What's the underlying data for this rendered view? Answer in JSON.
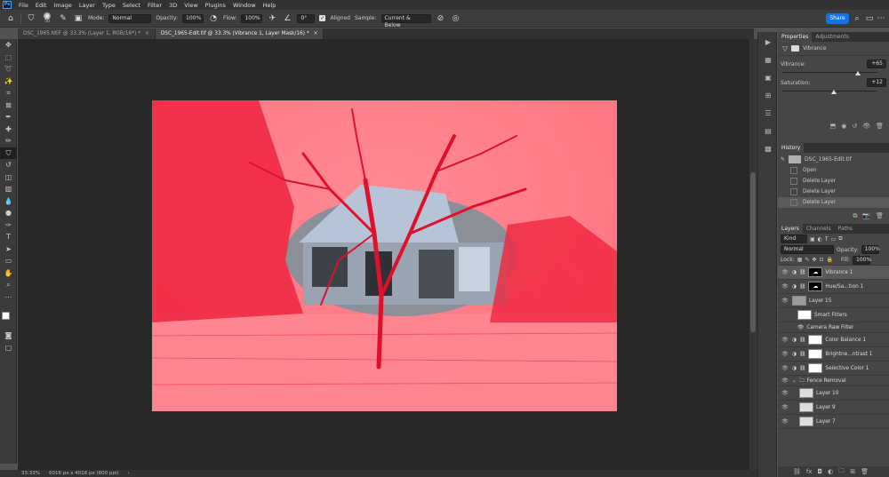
{
  "menubar": {
    "logo": "Ps",
    "items": [
      "File",
      "Edit",
      "Image",
      "Layer",
      "Type",
      "Select",
      "Filter",
      "3D",
      "View",
      "Plugins",
      "Window",
      "Help"
    ]
  },
  "options": {
    "brush_size": "50",
    "mode_label": "Mode:",
    "mode_value": "Normal",
    "opacity_label": "Opacity:",
    "opacity_value": "100%",
    "flow_label": "Flow:",
    "flow_value": "100%",
    "angle_value": "0°",
    "aligned_label": "Aligned",
    "sample_label": "Sample:",
    "sample_value": "Current & Below",
    "share_label": "Share"
  },
  "tabs": [
    {
      "label": "DSC_1965.NEF @ 33.3% (Layer 1, RGB/16*) *",
      "close": "×"
    },
    {
      "label": "DSC_1965-Edit.tif @ 33.3% (Vibrance 1, Layer Mask/16) *",
      "close": "×"
    }
  ],
  "status": {
    "zoom": "33.33%",
    "doc_info": "6016 px x 4016 px (600 ppi)",
    "arrow": "›"
  },
  "properties": {
    "tab_properties": "Properties",
    "tab_adjustments": "Adjustments",
    "adj_name": "Vibrance",
    "vibrance_label": "Vibrance:",
    "vibrance_value": "+65",
    "vibrance_level": 0.825,
    "saturation_label": "Saturation:",
    "saturation_value": "+12",
    "saturation_level": 0.56
  },
  "history": {
    "tab": "History",
    "snapshot": "DSC_1965-Edit.tif",
    "items": [
      "Open",
      "Delete Layer",
      "Delete Layer",
      "Delete Layer"
    ]
  },
  "layers": {
    "tab_layers": "Layers",
    "tab_channels": "Channels",
    "tab_paths": "Paths",
    "kind_label": "Kind",
    "blend_mode": "Normal",
    "opacity_label": "Opacity:",
    "opacity_value": "100%",
    "lock_label": "Lock:",
    "fill_label": "Fill:",
    "fill_value": "100%",
    "rows": [
      {
        "name": "Vibrance 1",
        "selected": true
      },
      {
        "name": "Hue/Sa...tion 1",
        "selected": false
      },
      {
        "name": "Layer 15",
        "selected": false
      },
      {
        "name": "Smart Filters",
        "selected": false
      },
      {
        "name": "Camera Raw Filter",
        "selected": false
      },
      {
        "name": "Color Balance 1",
        "selected": false
      },
      {
        "name": "Brightne...ntrast 1",
        "selected": false
      },
      {
        "name": "Selective Color 1",
        "selected": false
      },
      {
        "name": "Fence Removal",
        "selected": false
      },
      {
        "name": "Layer 10",
        "selected": false
      },
      {
        "name": "Layer 9",
        "selected": false
      },
      {
        "name": "Layer 7",
        "selected": false
      }
    ]
  },
  "colors": {
    "mask_overlay": "#ff7280",
    "accent": "#1473e6",
    "canvas_bg": "#282828"
  }
}
